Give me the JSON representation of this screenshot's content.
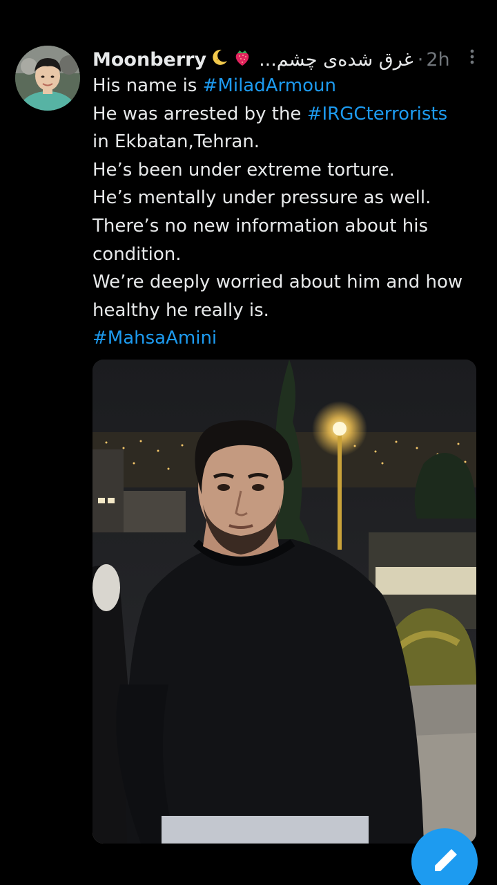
{
  "tweet": {
    "display_name": "Moonberry",
    "emoji_moon": "moon-icon",
    "emoji_strawberry": "strawberry-icon",
    "handle_name": "غرق شده‌ی چشم...",
    "separator": "·",
    "time": "2h",
    "lines": {
      "l1_text": "His name is ",
      "l1_tag": "#MiladArmoun",
      "l2_text": "He was arrested by the ",
      "l2_tag": "#IRGCterrorists",
      "l3": "in Ekbatan,Tehran.",
      "l4": "He’s been under extreme torture.",
      "l5": "He’s mentally under pressure as well.",
      "l6": "There’s no new information about his",
      "l7": "condition.",
      "l8": "We’re deeply worried about him and how",
      "l9": "healthy he really is.",
      "l10_tag": "#MahsaAmini"
    },
    "colors": {
      "hashtag": "#1d9bf0",
      "text": "#e7e9ea",
      "secondary": "#71767b",
      "background": "#000000"
    }
  }
}
